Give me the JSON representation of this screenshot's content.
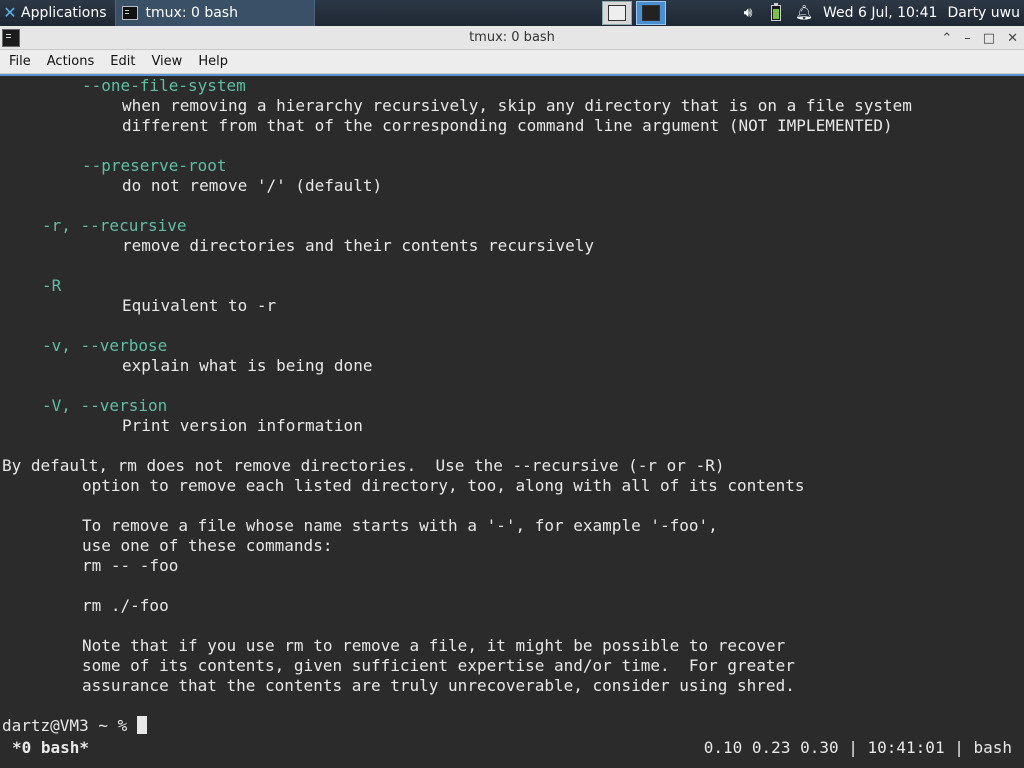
{
  "panel": {
    "apps_label": "Applications",
    "taskbar_title": "tmux: 0 bash",
    "clock": "Wed  6 Jul, 10:41",
    "user": "Darty uwu"
  },
  "window": {
    "title": "tmux: 0 bash"
  },
  "menu": [
    "File",
    "Actions",
    "Edit",
    "View",
    "Help"
  ],
  "terminal": {
    "lines": [
      {
        "t": "--one-file-system",
        "cls": "c-opt",
        "indent": 4
      },
      {
        "t": "when removing a hierarchy recursively, skip any directory that is on a file system",
        "indent": 6
      },
      {
        "t": "different from that of the corresponding command line argument (NOT IMPLEMENTED)",
        "indent": 6
      },
      {
        "t": "",
        "indent": 0
      },
      {
        "t": "--preserve-root",
        "cls": "c-opt",
        "indent": 4
      },
      {
        "t": "do not remove '/' (default)",
        "indent": 6
      },
      {
        "t": "",
        "indent": 0
      },
      {
        "t": "-r, --recursive",
        "cls": "c-opt",
        "indent": 2
      },
      {
        "t": "remove directories and their contents recursively",
        "indent": 6
      },
      {
        "t": "",
        "indent": 0
      },
      {
        "t": "-R",
        "cls": "c-opt",
        "indent": 2
      },
      {
        "t": "Equivalent to -r",
        "indent": 6
      },
      {
        "t": "",
        "indent": 0
      },
      {
        "t": "-v, --verbose",
        "cls": "c-opt",
        "indent": 2
      },
      {
        "t": "explain what is being done",
        "indent": 6
      },
      {
        "t": "",
        "indent": 0
      },
      {
        "t": "-V, --version",
        "cls": "c-opt",
        "indent": 2
      },
      {
        "t": "Print version information",
        "indent": 6
      },
      {
        "t": "",
        "indent": 0
      },
      {
        "t": "By default, rm does not remove directories.  Use the --recursive (-r or -R)",
        "indent": 0
      },
      {
        "t": "option to remove each listed directory, too, along with all of its contents",
        "indent": 4
      },
      {
        "t": "",
        "indent": 0
      },
      {
        "t": "To remove a file whose name starts with a '-', for example '-foo',",
        "indent": 4
      },
      {
        "t": "use one of these commands:",
        "indent": 4
      },
      {
        "t": "rm -- -foo",
        "indent": 4
      },
      {
        "t": "",
        "indent": 0
      },
      {
        "t": "rm ./-foo",
        "indent": 4
      },
      {
        "t": "",
        "indent": 0
      },
      {
        "t": "Note that if you use rm to remove a file, it might be possible to recover",
        "indent": 4
      },
      {
        "t": "some of its contents, given sufficient expertise and/or time.  For greater",
        "indent": 4
      },
      {
        "t": "assurance that the contents are truly unrecoverable, consider using shred.",
        "indent": 4
      }
    ],
    "prompt": "dartz@VM3 ~ % "
  },
  "tmux": {
    "window_label": "*0 bash*",
    "status_right": "0.10 0.23 0.30 | 10:41:01 | bash"
  },
  "colors": {
    "option_text": "#5fbfa3",
    "terminal_bg": "#2b2b2b",
    "terminal_fg": "#e8e8e8"
  }
}
